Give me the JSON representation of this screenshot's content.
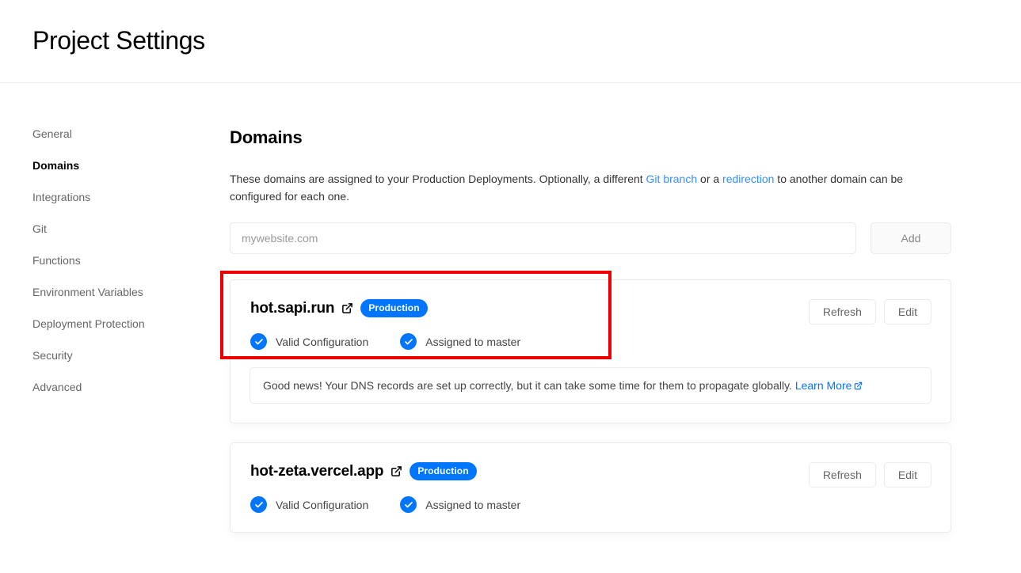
{
  "header": {
    "title": "Project Settings"
  },
  "sidebar": {
    "items": [
      {
        "label": "General",
        "active": false
      },
      {
        "label": "Domains",
        "active": true
      },
      {
        "label": "Integrations",
        "active": false
      },
      {
        "label": "Git",
        "active": false
      },
      {
        "label": "Functions",
        "active": false
      },
      {
        "label": "Environment Variables",
        "active": false
      },
      {
        "label": "Deployment Protection",
        "active": false
      },
      {
        "label": "Security",
        "active": false
      },
      {
        "label": "Advanced",
        "active": false
      }
    ]
  },
  "main": {
    "section_title": "Domains",
    "description": {
      "part1": "These domains are assigned to your Production Deployments. Optionally, a different ",
      "link1": "Git branch",
      "part2": " or a ",
      "link2": "redirection",
      "part3": " to another domain can be configured for each one."
    },
    "add_domain": {
      "placeholder": "mywebsite.com",
      "value": "",
      "button_label": "Add"
    },
    "domains": [
      {
        "name": "hot.sapi.run",
        "badge": "Production",
        "statuses": [
          {
            "label": "Valid Configuration"
          },
          {
            "label": "Assigned to master"
          }
        ],
        "refresh_label": "Refresh",
        "edit_label": "Edit",
        "notice": {
          "text": "Good news! Your DNS records are set up correctly, but it can take some time for them to propagate globally. ",
          "link": "Learn More"
        },
        "highlighted": true
      },
      {
        "name": "hot-zeta.vercel.app",
        "badge": "Production",
        "statuses": [
          {
            "label": "Valid Configuration"
          },
          {
            "label": "Assigned to master"
          }
        ],
        "refresh_label": "Refresh",
        "edit_label": "Edit",
        "notice": null,
        "highlighted": false
      }
    ]
  },
  "colors": {
    "accent_blue": "#0076ff",
    "link_blue": "#3291ff",
    "highlight_red": "#ee0000",
    "border": "#eaeaea"
  },
  "icons": {
    "external_link": "external-link-icon",
    "check": "check-icon"
  }
}
